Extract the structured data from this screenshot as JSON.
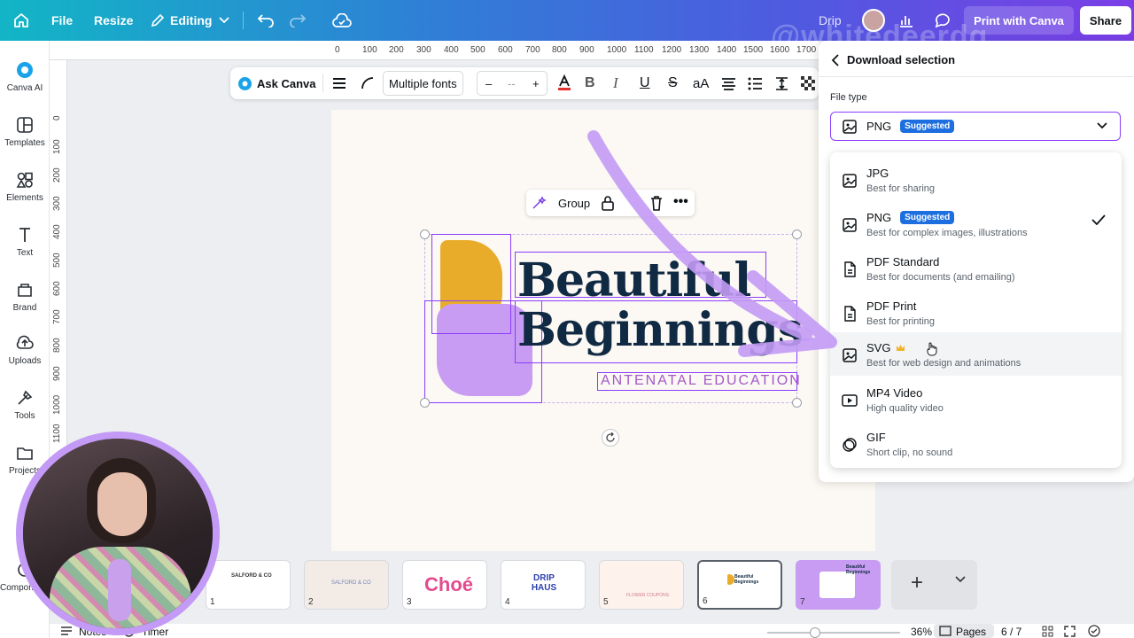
{
  "topbar": {
    "file_label": "File",
    "resize_label": "Resize",
    "editing_label": "Editing",
    "drip_label": "Drip",
    "print_label": "Print with Canva",
    "share_label": "Share",
    "watermark": "@whitedeerdg",
    "gradient_colors": [
      "#12b5c6",
      "#4f5ae0",
      "#7b3ee6"
    ]
  },
  "leftrail": {
    "items": [
      {
        "label": "Canva AI",
        "icon": "canva-ai-icon"
      },
      {
        "label": "Templates",
        "icon": "templates-icon"
      },
      {
        "label": "Elements",
        "icon": "elements-icon"
      },
      {
        "label": "Text",
        "icon": "text-icon"
      },
      {
        "label": "Brand",
        "icon": "brand-icon"
      },
      {
        "label": "Uploads",
        "icon": "uploads-icon"
      },
      {
        "label": "Tools",
        "icon": "tools-icon"
      },
      {
        "label": "Projects",
        "icon": "projects-icon"
      },
      {
        "label": "Components",
        "icon": "components-icon"
      }
    ]
  },
  "ruler": {
    "top": [
      "0",
      "100",
      "200",
      "300",
      "400",
      "500",
      "600",
      "700",
      "800",
      "900",
      "1000",
      "1100",
      "1200",
      "1300",
      "1400",
      "1500",
      "1600",
      "1700"
    ],
    "left": [
      "0",
      "100",
      "200",
      "300",
      "400",
      "500",
      "600",
      "700",
      "800",
      "900",
      "1000",
      "1100"
    ]
  },
  "toolbar": {
    "ask_canva": "Ask Canva",
    "font_label": "Multiple fonts",
    "size_minus": "–",
    "size_value": "--",
    "size_plus": "+",
    "case_label": "aA",
    "accent_color": "#e0312e"
  },
  "canvas": {
    "group_label": "Group",
    "title_line1": "Beautiful",
    "title_line2": "Beginnings",
    "subtitle": "ANTENATAL EDUCATION",
    "shape_colors": {
      "yellow": "#e9ac2a",
      "lilac": "#c79cf2",
      "title": "#102a43",
      "subtitle": "#a259c9"
    },
    "background": "#fcf8f4"
  },
  "panel": {
    "header": "Download selection",
    "file_type_label": "File type",
    "selected_value": "PNG",
    "selected_badge": "Suggested",
    "options": [
      {
        "name": "JPG",
        "desc": "Best for sharing",
        "icon": "image-icon"
      },
      {
        "name": "PNG",
        "desc": "Best for complex images, illustrations",
        "badge": "Suggested",
        "checked": true,
        "icon": "image-icon"
      },
      {
        "name": "PDF Standard",
        "desc": "Best for documents (and emailing)",
        "icon": "document-icon"
      },
      {
        "name": "PDF Print",
        "desc": "Best for printing",
        "icon": "document-icon"
      },
      {
        "name": "SVG",
        "desc": "Best for web design and animations",
        "premium": true,
        "icon": "image-icon"
      },
      {
        "name": "MP4 Video",
        "desc": "High quality video",
        "icon": "video-icon"
      },
      {
        "name": "GIF",
        "desc": "Short clip, no sound",
        "icon": "gif-icon"
      }
    ]
  },
  "pages": {
    "thumbs": [
      {
        "num": "1",
        "label": "SALFORD & CO"
      },
      {
        "num": "2",
        "label": "SALFORD & CO"
      },
      {
        "num": "3",
        "label": "Choé"
      },
      {
        "num": "4",
        "label": "DRIP HAUS"
      },
      {
        "num": "5",
        "label": "FLOWER COUPONS"
      },
      {
        "num": "6",
        "label": "Beautiful Beginnings"
      },
      {
        "num": "7",
        "label": "Beautiful Beginnings"
      }
    ],
    "add_label": "+",
    "expand_label": "⌄"
  },
  "bottombar": {
    "notes": "Notes",
    "timer": "Timer",
    "zoom": "36%",
    "pages_label": "Pages",
    "page_count": "6 / 7",
    "zoom_fraction": 0.36
  }
}
